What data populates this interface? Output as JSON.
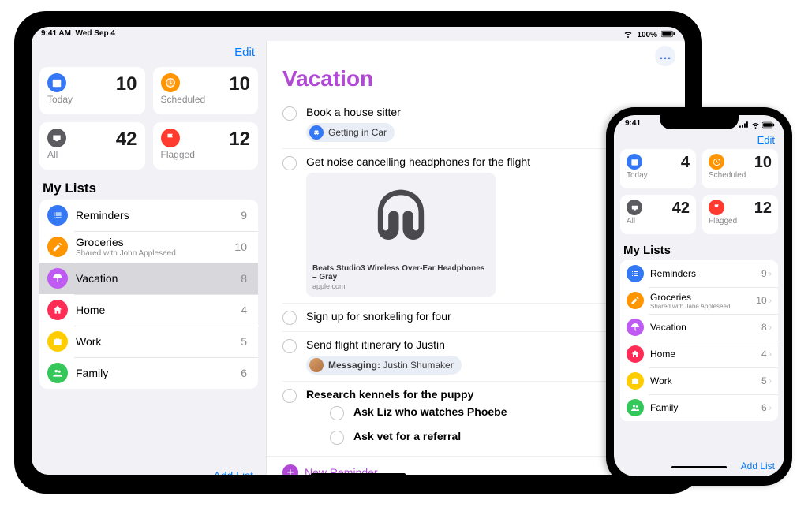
{
  "ipad": {
    "status": {
      "time": "9:41 AM",
      "date": "Wed Sep 4",
      "battery": "100%",
      "wifi": "wifi-icon"
    },
    "sidebar": {
      "edit_label": "Edit",
      "cards": {
        "today": {
          "label": "Today",
          "count": 10,
          "icon": "calendar-icon",
          "color": "bg-blue"
        },
        "scheduled": {
          "label": "Scheduled",
          "count": 10,
          "icon": "clock-icon",
          "color": "bg-orange"
        },
        "all": {
          "label": "All",
          "count": 42,
          "icon": "tray-icon",
          "color": "bg-grey"
        },
        "flagged": {
          "label": "Flagged",
          "count": 12,
          "icon": "flag-icon",
          "color": "bg-red"
        }
      },
      "mylists_title": "My Lists",
      "lists": [
        {
          "name": "Reminders",
          "count": 9,
          "icon": "list-icon",
          "color": "bg-blue",
          "selected": false
        },
        {
          "name": "Groceries",
          "count": 10,
          "icon": "pencil-icon",
          "color": "bg-orange",
          "selected": false,
          "subtitle": "Shared with John Appleseed"
        },
        {
          "name": "Vacation",
          "count": 8,
          "icon": "umbrella-icon",
          "color": "bg-purple",
          "selected": true
        },
        {
          "name": "Home",
          "count": 4,
          "icon": "home-icon",
          "color": "bg-pink",
          "selected": false
        },
        {
          "name": "Work",
          "count": 5,
          "icon": "briefcase-icon",
          "color": "bg-yellow",
          "selected": false
        },
        {
          "name": "Family",
          "count": 6,
          "icon": "people-icon",
          "color": "bg-green",
          "selected": false
        }
      ],
      "add_list_label": "Add List"
    },
    "main": {
      "title": "Vacation",
      "more_glyph": "…",
      "new_reminder_label": "New Reminder",
      "items": [
        {
          "title": "Book a house sitter",
          "chip": {
            "icon": "car-icon",
            "label": "Getting in Car"
          }
        },
        {
          "title": "Get noise cancelling headphones for the flight",
          "attachment": {
            "caption": "Beats Studio3 Wireless Over-Ear Headphones – Gray",
            "source": "apple.com"
          }
        },
        {
          "title": "Sign up for snorkeling for four"
        },
        {
          "title": "Send flight itinerary to Justin",
          "msg_chip": {
            "prefix": "Messaging:",
            "person": "Justin Shumaker"
          }
        },
        {
          "title": "Research kennels for the puppy",
          "bold": true,
          "subtasks": [
            "Ask Liz who watches Phoebe",
            "Ask vet for a referral"
          ]
        }
      ]
    }
  },
  "iphone": {
    "status": {
      "time": "9:41"
    },
    "edit_label": "Edit",
    "cards": {
      "today": {
        "label": "Today",
        "count": 4,
        "color": "bg-blue"
      },
      "scheduled": {
        "label": "Scheduled",
        "count": 10,
        "color": "bg-orange"
      },
      "all": {
        "label": "All",
        "count": 42,
        "color": "bg-grey"
      },
      "flagged": {
        "label": "Flagged",
        "count": 12,
        "color": "bg-red"
      }
    },
    "mylists_title": "My Lists",
    "lists": [
      {
        "name": "Reminders",
        "count": 9,
        "color": "bg-blue"
      },
      {
        "name": "Groceries",
        "count": 10,
        "color": "bg-orange",
        "subtitle": "Shared with Jane Appleseed"
      },
      {
        "name": "Vacation",
        "count": 8,
        "color": "bg-purple"
      },
      {
        "name": "Home",
        "count": 4,
        "color": "bg-pink"
      },
      {
        "name": "Work",
        "count": 5,
        "color": "bg-yellow"
      },
      {
        "name": "Family",
        "count": 6,
        "color": "bg-green"
      }
    ],
    "add_list_label": "Add List"
  }
}
